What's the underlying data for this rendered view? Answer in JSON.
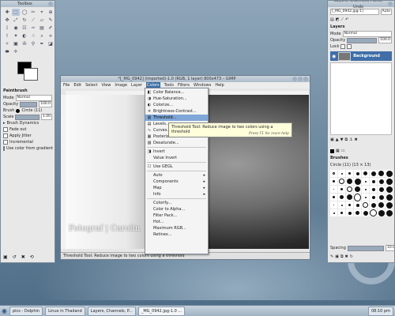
{
  "toolbox": {
    "title": "Toolbox",
    "tool_icons": [
      "✚",
      "⬚",
      "◯",
      "✂",
      "⌖",
      "⊕",
      "✥",
      "⤢",
      "↻",
      "⟋",
      "▱",
      "✎",
      "⟟",
      "◉",
      "☷",
      "✑",
      "▤",
      "✐",
      "⌇",
      "✦",
      "◐",
      "☝",
      "⌕",
      "⟡",
      "✧",
      "▣",
      "✇",
      "⚲",
      "✒",
      "◪",
      "⬬",
      "✛"
    ],
    "active_tool_index": 1,
    "tool_options_title": "Paintbrush",
    "mode_label": "Mode",
    "mode_value": "Normal",
    "opacity_label": "Opacity",
    "opacity_value": "100.0",
    "brush_label": "Brush",
    "brush_value": "Circle (11)",
    "scale_label": "Scale",
    "scale_value": "1.00",
    "brush_dynamics": "Brush Dynamics",
    "fade_out": "Fade out",
    "apply_jitter": "Apply Jitter",
    "incremental": "Incremental",
    "use_color_gradient": "Use color from gradient"
  },
  "gimp_window": {
    "title": "*[_MG_0942] (imported)-1.0 (RGB, 1 layer) 800x473 – GIMP",
    "menus": [
      "File",
      "Edit",
      "Select",
      "View",
      "Image",
      "Layer",
      "Colors",
      "Tools",
      "Filters",
      "Windows",
      "Help"
    ],
    "active_menu": "Colors",
    "watermark": "Fotograf | Carolin",
    "status": "Threshold Tool: Reduce image to two colors using a threshold"
  },
  "colors_menu": [
    {
      "label": "Color Balance...",
      "icon": "◧"
    },
    {
      "label": "Hue-Saturation...",
      "icon": "◑"
    },
    {
      "label": "Colorize...",
      "icon": "◐"
    },
    {
      "label": "Brightness-Contrast...",
      "icon": "☀"
    },
    {
      "label": "Threshold...",
      "icon": "▥",
      "highlight": true
    },
    {
      "label": "Levels...",
      "icon": "▤"
    },
    {
      "label": "Curves...",
      "icon": "∿"
    },
    {
      "label": "Posterize...",
      "icon": "▦"
    },
    {
      "label": "Desaturate...",
      "icon": "▨"
    },
    {
      "sep": true
    },
    {
      "label": "Invert",
      "icon": "◨"
    },
    {
      "label": "Value Invert",
      "icon": ""
    },
    {
      "sep": true
    },
    {
      "label": "Use GEGL",
      "icon": "☐"
    },
    {
      "sep": true
    },
    {
      "label": "Auto",
      "submenu": true
    },
    {
      "label": "Components",
      "submenu": true
    },
    {
      "label": "Map",
      "submenu": true
    },
    {
      "label": "Info",
      "submenu": true
    },
    {
      "sep": true
    },
    {
      "label": "Colorify...",
      "icon": ""
    },
    {
      "label": "Color to Alpha...",
      "icon": ""
    },
    {
      "label": "Filter Pack...",
      "icon": ""
    },
    {
      "label": "Hot...",
      "icon": ""
    },
    {
      "label": "Maximum RGB...",
      "icon": ""
    },
    {
      "label": "Retinex...",
      "icon": ""
    }
  ],
  "tooltip": {
    "text": "Threshold Tool: Reduce image to two colors using a threshold",
    "hint": "Press F1 for more help"
  },
  "layers_panel": {
    "title": "Layers, Channels, Paths, Undo",
    "image_select": "[_MG_0942.jpg-1]",
    "auto_label": "Auto",
    "section": "Layers",
    "mode_label": "Mode",
    "mode_value": "Normal",
    "opacity_label": "Opacity",
    "opacity_value": "100.0",
    "lock_label": "Lock",
    "layer_name": "Background",
    "brushes_title": "Brushes",
    "brush_info": "Circle (11) (13 × 13)",
    "spacing_label": "Spacing",
    "spacing_value": "10.0"
  },
  "taskbar": {
    "tasks": [
      "pics - Dolphin",
      "Linux in Thailand",
      "Layers, Channels, P...",
      "_MG_0942.jpg-1.0 ..."
    ],
    "active_index": 3,
    "clock": "08:10 pm"
  },
  "colors": {
    "menu_highlight": "#7fa8d8",
    "selected_layer": "#3f6ea8",
    "tooltip_bg": "#ffffdc"
  }
}
